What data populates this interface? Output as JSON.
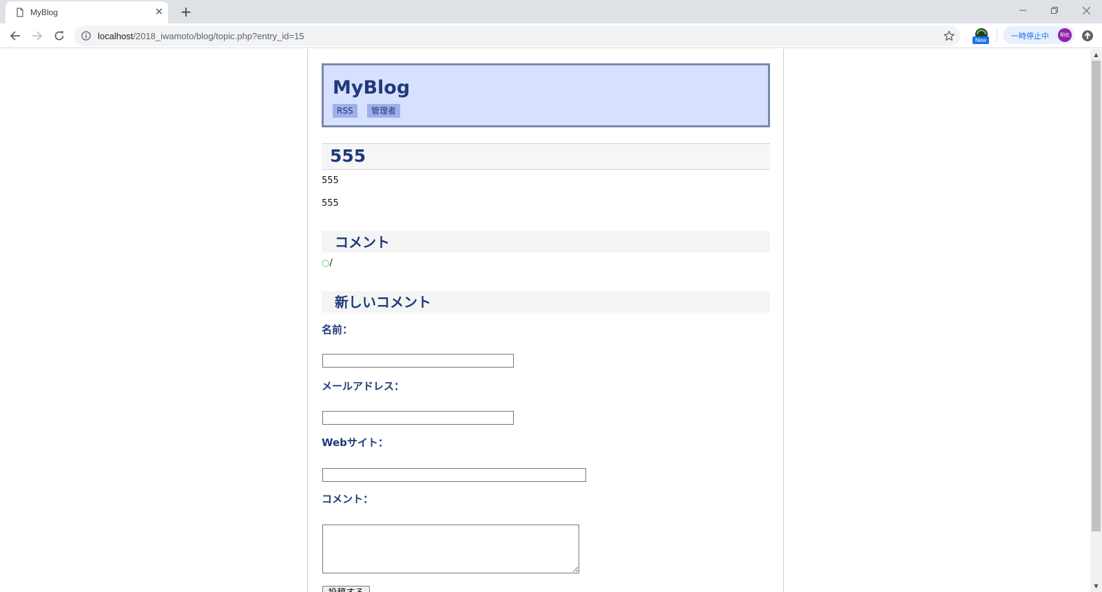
{
  "browser": {
    "tab_title": "MyBlog",
    "url_host": "localhost",
    "url_path": "/2018_iwamoto/blog/topic.php?entry_id=15",
    "extension_badge": "New",
    "pause_label": "一時停止中",
    "profile_initials": "明也",
    "icons": {
      "tab_favicon": "page-icon",
      "tab_close": "close-icon",
      "new_tab": "plus-icon",
      "back": "arrow-left-icon",
      "forward": "arrow-right-icon",
      "reload": "reload-icon",
      "site_info": "info-icon",
      "bookmark": "star-icon",
      "update": "arrow-up-circle-icon"
    }
  },
  "site": {
    "title": "MyBlog",
    "nav": [
      "RSS",
      "管理者"
    ]
  },
  "entry": {
    "title": "555",
    "body_lines": [
      "555",
      "555"
    ]
  },
  "comments": {
    "heading": "コメント",
    "items": [
      {
        "bullet": "○",
        "text": "/"
      }
    ]
  },
  "new_comment": {
    "heading": "新しいコメント",
    "name_label": "名前：",
    "name_value": "",
    "email_label": "メールアドレス：",
    "email_value": "",
    "website_label": "Webサイト：",
    "website_value": "",
    "comment_label": "コメント：",
    "comment_value": "",
    "submit_label": "投稿する"
  },
  "colors": {
    "heading": "#1f3a7a",
    "header_bg": "#d8e0ff",
    "header_border": "#7a87ad",
    "nav_bg": "#9eb0e6",
    "bullet": "#47c44d"
  }
}
